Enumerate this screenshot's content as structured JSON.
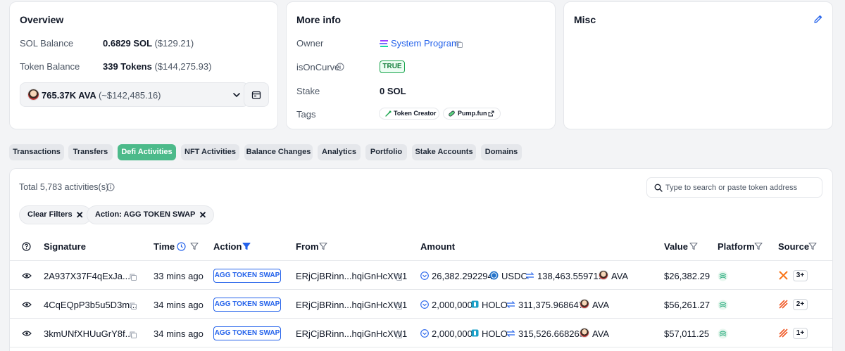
{
  "overview": {
    "title": "Overview",
    "sol_label": "SOL Balance",
    "sol_value": "0.6829 SOL",
    "sol_usd": "($129.21)",
    "token_label": "Token Balance",
    "token_value": "339 Tokens",
    "token_usd": "($144,275.93)",
    "selected_token": "765.37K AVA",
    "selected_token_usd": "(~$142,485.16)"
  },
  "more_info": {
    "title": "More info",
    "owner_label": "Owner",
    "owner_value": "System Program",
    "curve_label": "isOnCurve",
    "curve_value": "TRUE",
    "stake_label": "Stake",
    "stake_value": "0 SOL",
    "tags_label": "Tags",
    "tags": [
      "Token Creator",
      "Pump.fun"
    ]
  },
  "misc": {
    "title": "Misc"
  },
  "tabs": [
    "Transactions",
    "Transfers",
    "Defi Activities",
    "NFT Activities",
    "Balance Changes",
    "Analytics",
    "Portfolio",
    "Stake Accounts",
    "Domains"
  ],
  "active_tab": "Defi Activities",
  "activities": {
    "total": "Total 5,783 activities(s)",
    "search_placeholder": "Type to search or paste token address",
    "filters": [
      "Clear Filters",
      "Action: AGG TOKEN SWAP"
    ],
    "columns": [
      "Signature",
      "Time",
      "Action",
      "From",
      "Amount",
      "Value",
      "Platform",
      "Source"
    ],
    "rows": [
      {
        "signature": "2A937X37F4qExJa...",
        "time": "33 mins ago",
        "action": "AGG TOKEN SWAP",
        "from": "ERjCjBRinn...hqiGnHcXW1",
        "amount_in": "26,382.292294",
        "token_in": "USDC",
        "amount_out": "138,463.559719",
        "token_out": "AVA",
        "value": "$26,382.29",
        "source_count": "3+"
      },
      {
        "signature": "4CqEQpP3b5u5D3m...",
        "time": "34 mins ago",
        "action": "AGG TOKEN SWAP",
        "from": "ERjCjBRinn...hqiGnHcXW1",
        "amount_in": "2,000,000",
        "token_in": "HOLO",
        "amount_out": "311,375.968647",
        "token_out": "AVA",
        "value": "$56,261.27",
        "source_count": "2+"
      },
      {
        "signature": "3kmUNfXHUuGrY8f...",
        "time": "34 mins ago",
        "action": "AGG TOKEN SWAP",
        "from": "ERjCjBRinn...hqiGnHcXW1",
        "amount_in": "2,000,000",
        "token_in": "HOLO",
        "amount_out": "315,526.668263",
        "token_out": "AVA",
        "value": "$57,011.25",
        "source_count": "1+"
      }
    ]
  },
  "colors": {
    "accent": "#4cba8a",
    "link": "#2563eb",
    "true_badge": "#16a34a"
  }
}
